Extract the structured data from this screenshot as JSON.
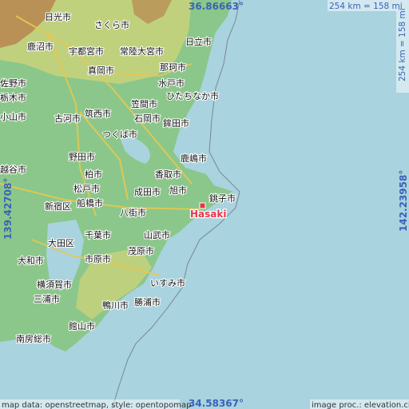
{
  "coords": {
    "north": "36.86663°",
    "south": "34.58367°",
    "west": "139.42708°",
    "east": "142.23958°"
  },
  "scale": {
    "horizontal": "254 km = 158 mi",
    "vertical": "254 km = 158 mi"
  },
  "marker": {
    "label": "Hasaki",
    "color": "#e8334a"
  },
  "cities": [
    "日光市",
    "さくら市",
    "日立市",
    "鹿沼市",
    "宇都宮市",
    "常陸大宮市",
    "那珂市",
    "真岡市",
    "水戸市",
    "ひたちなか市",
    "笠間市",
    "石岡市",
    "鉾田市",
    "古河市",
    "筑西市",
    "つくば市",
    "野田市",
    "鹿嶋市",
    "柏市",
    "成田市",
    "銚子市",
    "松戸市",
    "船橋市",
    "新宿区",
    "香取市",
    "旭市",
    "千葉市",
    "大田区",
    "山武市",
    "市原市",
    "茂原市",
    "大和市",
    "横須賀市",
    "いすみ市",
    "勝浦市",
    "三浦市",
    "鴨川市",
    "館山市",
    "南房総市",
    "佐野市",
    "栃木市",
    "小山市",
    "越谷市",
    "八街市"
  ],
  "credits": {
    "left": "map data: openstreetmap, style: opentopomap",
    "right": "image proc.: elevation.city"
  },
  "colors": {
    "sea": "#a9d3de",
    "lowland": "#8bc78a",
    "hills": "#c9d27a",
    "mountains": "#b88a52",
    "coord_text": "#3a63b8"
  }
}
